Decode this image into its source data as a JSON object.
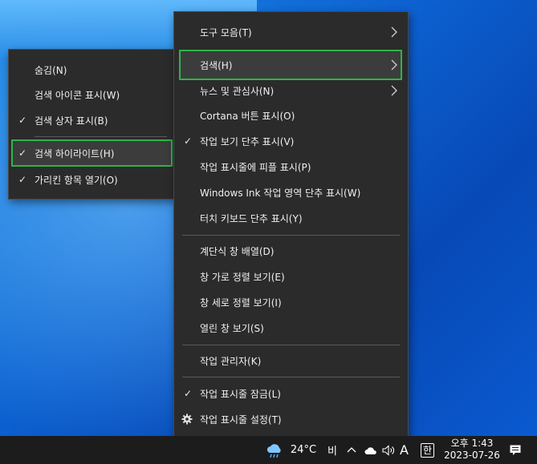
{
  "main_menu": {
    "items": [
      {
        "label": "도구 모음(T)",
        "check": "",
        "submenu": true
      },
      {
        "label": "검색(H)",
        "check": "",
        "submenu": true
      },
      {
        "label": "뉴스 및 관심사(N)",
        "check": "",
        "submenu": true
      },
      {
        "label": "Cortana 버튼 표시(O)",
        "check": ""
      },
      {
        "label": "작업 보기 단추 표시(V)",
        "check": "✓"
      },
      {
        "label": "작업 표시줄에 피플 표시(P)",
        "check": ""
      },
      {
        "label": "Windows Ink 작업 영역 단추 표시(W)",
        "check": ""
      },
      {
        "label": "터치 키보드 단추 표시(Y)",
        "check": ""
      },
      {
        "label": "계단식 창 배열(D)",
        "check": ""
      },
      {
        "label": "창 가로 정렬 보기(E)",
        "check": ""
      },
      {
        "label": "창 세로 정렬 보기(I)",
        "check": ""
      },
      {
        "label": "열린 창 보기(S)",
        "check": ""
      },
      {
        "label": "작업 관리자(K)",
        "check": ""
      },
      {
        "label": "작업 표시줄 잠금(L)",
        "check": "✓"
      },
      {
        "label": "작업 표시줄 설정(T)",
        "icon": "gear-icon"
      }
    ]
  },
  "search_submenu": {
    "items": [
      {
        "label": "숨김(N)",
        "check": ""
      },
      {
        "label": "검색 아이콘 표시(W)",
        "check": ""
      },
      {
        "label": "검색 상자 표시(B)",
        "check": "✓"
      },
      {
        "label": "검색 하이라이트(H)",
        "check": "✓"
      },
      {
        "label": "가리킨 항목 열기(O)",
        "check": "✓"
      }
    ]
  },
  "taskbar": {
    "weather_icon": "cloud-rain-icon",
    "temperature": "24°C",
    "weather_text": "비",
    "ime_mode": "A",
    "ime_lang": "한",
    "time": "오후 1:43",
    "date": "2023-07-26"
  },
  "colors": {
    "highlight_border": "#2fb44a",
    "menu_bg": "#2b2b2b",
    "taskbar_bg": "#1c1c1c"
  }
}
